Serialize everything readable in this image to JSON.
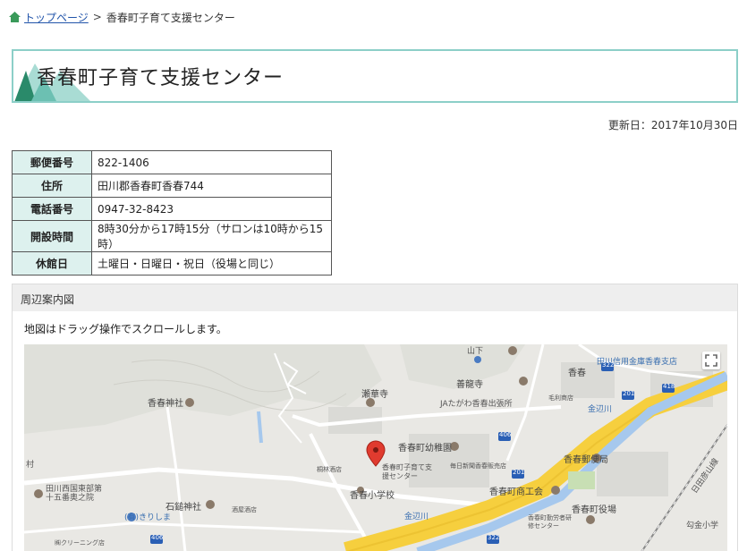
{
  "breadcrumb": {
    "home_label": "トップページ",
    "separator": ">",
    "current": "香春町子育て支援センター"
  },
  "page_title": "香春町子育て支援センター",
  "updated": "更新日：2017年10月30日",
  "info_table": [
    {
      "label": "郵便番号",
      "value": "822-1406"
    },
    {
      "label": "住所",
      "value": "田川郡香春町香春744"
    },
    {
      "label": "電話番号",
      "value": "0947-32-8423"
    },
    {
      "label": "開設時間",
      "value": "8時30分から17時15分（サロンは10時から15時）"
    },
    {
      "label": "休館日",
      "value": "土曜日・日曜日・祝日（役場と同じ）"
    }
  ],
  "map_panel": {
    "title": "周辺案内図",
    "note": "地図はドラッグ操作でスクロールします。",
    "labels": {
      "shrine_kawara": "香春神社",
      "temple_reinsou": "瀬華寺",
      "temple_zenryu": "善龍寺",
      "yamashita": "山下",
      "ja": "JAたがわ香春出張所",
      "bank": "田川信用金庫香春支店",
      "kawara": "香春",
      "kindergarten": "香春町幼稚園",
      "marker_label": "香春町子育て支援センター",
      "school": "香春小学校",
      "commerce": "香春町商工会",
      "post": "香春郵便局",
      "town_office": "香春町役場",
      "river1": "金辺川",
      "river2": "金辺川",
      "nishi": "田川西国東部第十五番奥之院",
      "ishida": "石鎚神社",
      "kirishima": "(有)きりしま",
      "minami": "勾金小学",
      "hitahikosan": "日田彦山線",
      "shinbun": "毎日新聞香春販売店",
      "mobile": "毛利商店",
      "cleaning": "㈱クリーニング店",
      "matsubayashi": "桐林酒店",
      "sakai": "酒屋酒店",
      "kensyu": "香春町勤労者研修センター",
      "r322": "322",
      "r201": "201",
      "r418": "418",
      "r406": "406",
      "r406b": "406",
      "r322b": "322",
      "r201b": "201",
      "mura": "村"
    }
  },
  "colors": {
    "teal_border": "#8ccfc8",
    "th_bg": "#ddf1ee",
    "link": "#2255aa",
    "highway": "#f6cf3e",
    "river": "#a6c8ed"
  }
}
